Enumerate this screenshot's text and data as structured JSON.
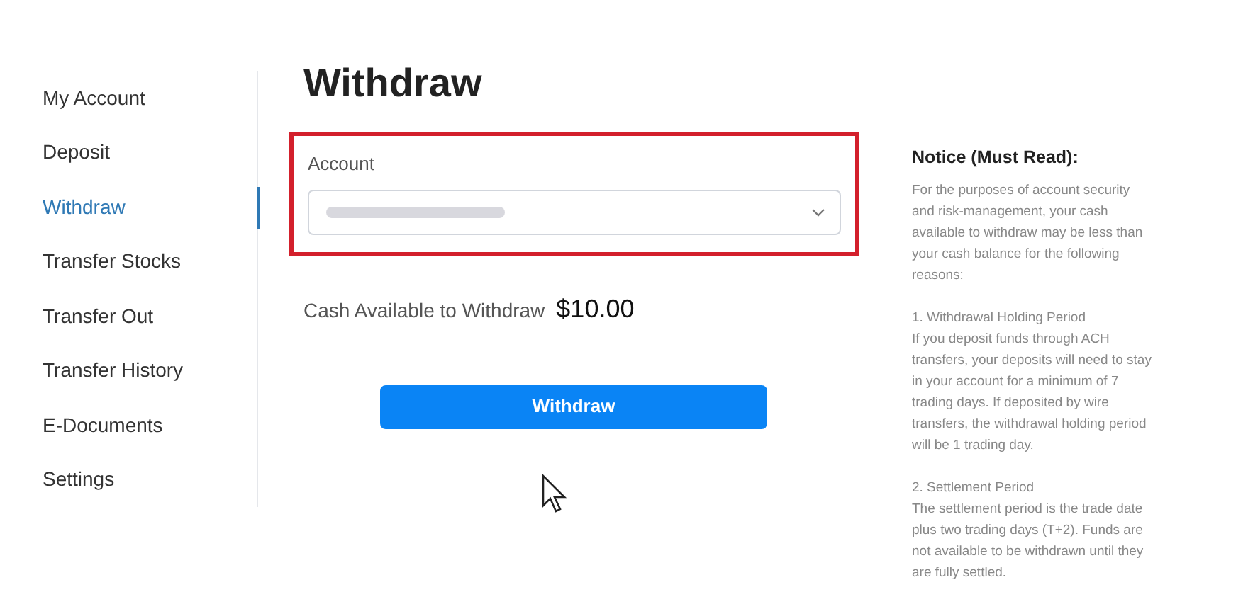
{
  "sidebar": {
    "items": [
      {
        "label": "My Account",
        "selected": false
      },
      {
        "label": "Deposit",
        "selected": false
      },
      {
        "label": "Withdraw",
        "selected": true
      },
      {
        "label": "Transfer Stocks",
        "selected": false
      },
      {
        "label": "Transfer Out",
        "selected": false
      },
      {
        "label": "Transfer History",
        "selected": false
      },
      {
        "label": "E-Documents",
        "selected": false
      },
      {
        "label": "Settings",
        "selected": false
      }
    ]
  },
  "page_title": "Withdraw",
  "account_field": {
    "label": "Account",
    "highlighted": true
  },
  "cash_available": {
    "label": "Cash Available to Withdraw",
    "amount": "$10.00"
  },
  "withdraw_button": "Withdraw",
  "notice": {
    "title": "Notice (Must Read):",
    "paragraphs": [
      "For the purposes of account security and risk-management, your cash available to withdraw may be less than your cash balance for the following reasons:",
      "1. Withdrawal Holding Period\nIf you deposit funds through ACH transfers, your deposits will need to stay in your account for a minimum of 7 trading days. If deposited by wire transfers, the withdrawal holding period will be 1 trading day.",
      "2. Settlement Period\nThe settlement period is the trade date plus two trading days (T+2). Funds are not available to be withdrawn until they are fully settled."
    ]
  }
}
